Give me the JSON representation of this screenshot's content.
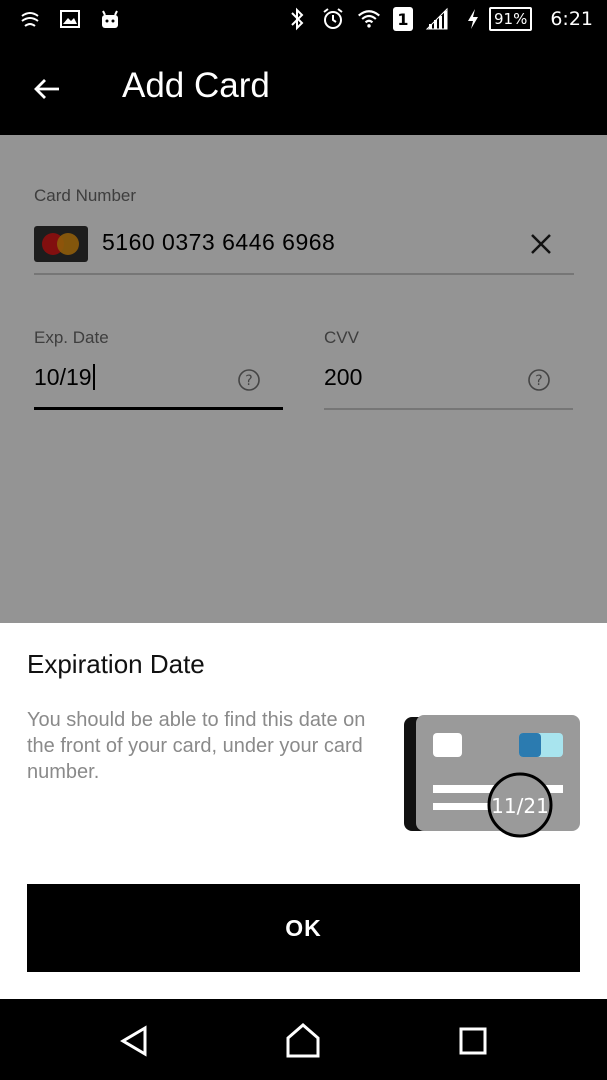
{
  "status_bar": {
    "battery_percent": "91%",
    "time": "6:21",
    "sim_slot": "1",
    "left_icons": [
      "link-icon",
      "image-icon",
      "android-icon"
    ],
    "right_icons": [
      "bluetooth-icon",
      "alarm-icon",
      "wifi-icon",
      "sim-icon",
      "signal-icon",
      "charging-icon",
      "battery-icon"
    ]
  },
  "app_bar": {
    "title": "Add Card",
    "back_icon": "back-arrow-icon"
  },
  "form": {
    "card_number": {
      "label": "Card Number",
      "value": "5160 0373 6446 6968",
      "brand_icon": "mastercard-icon",
      "clear_icon": "close-icon"
    },
    "exp_date": {
      "label": "Exp. Date",
      "value": "10/19",
      "help_icon": "help-icon"
    },
    "cvv": {
      "label": "CVV",
      "value": "200",
      "help_icon": "help-icon"
    }
  },
  "sheet": {
    "title": "Expiration Date",
    "body": "You should be able to find this date on the front of your card, under your card number.",
    "illustration_date": "11/21",
    "ok_label": "OK"
  },
  "colors": {
    "card_gray": "#9a9a9a",
    "chip_blue": "#2b7bb0",
    "chip_light": "#a8e4ee",
    "mc_red": "#e01b1b",
    "mc_orange": "#f59f12"
  }
}
